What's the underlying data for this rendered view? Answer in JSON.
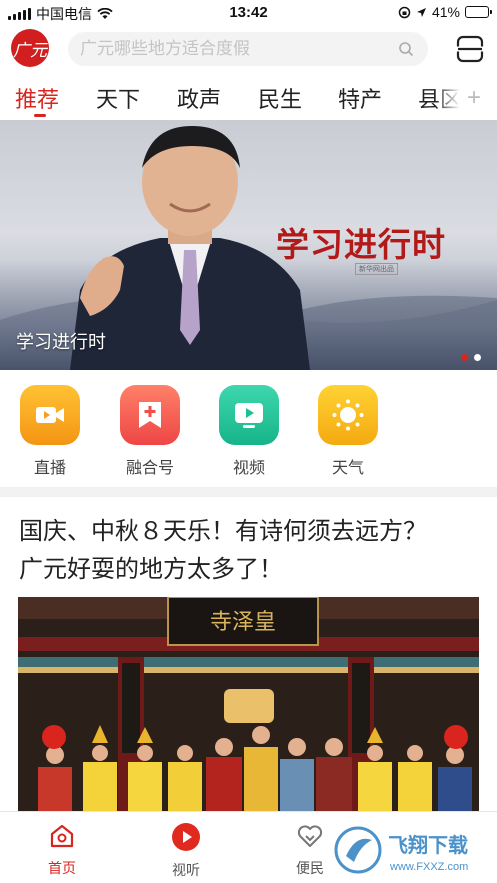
{
  "status_bar": {
    "carrier": "中国电信",
    "time": "13:42",
    "battery_percent_text": "41%",
    "battery_level": 0.41
  },
  "header": {
    "logo_text": "广元",
    "search_placeholder": "广元哪些地方适合度假",
    "icons": {
      "search": "search-icon",
      "scan": "scan-icon"
    }
  },
  "tabs": [
    {
      "label": "推荐",
      "active": true
    },
    {
      "label": "天下",
      "active": false
    },
    {
      "label": "政声",
      "active": false
    },
    {
      "label": "民生",
      "active": false
    },
    {
      "label": "特产",
      "active": false
    },
    {
      "label": "县区",
      "active": false
    }
  ],
  "tab_add_label": "+",
  "banner": {
    "slogan": "学习进行时",
    "sub_tag": "新华网出品",
    "caption": "学习进行时",
    "slide_count": 2,
    "active_slide": 1
  },
  "quick_actions": [
    {
      "label": "直播",
      "icon": "video-camera-icon",
      "color": "#f7a21b"
    },
    {
      "label": "融合号",
      "icon": "add-bookmark-icon",
      "color": "#f25a4b"
    },
    {
      "label": "视频",
      "icon": "play-screen-icon",
      "color": "#20c29a"
    },
    {
      "label": "天气",
      "icon": "sun-icon",
      "color": "#f5be1a"
    }
  ],
  "article": {
    "title_line1": "国庆、中秋８天乐！有诗何须去远方？",
    "title_line2": "广元好耍的地方太多了！",
    "image_sign_text": "寺泽皇"
  },
  "bottom_nav": [
    {
      "label": "首页",
      "icon": "home-icon",
      "active": true
    },
    {
      "label": "视听",
      "icon": "play-circle-icon",
      "active": false
    },
    {
      "label": "便民",
      "icon": "heart-icon",
      "active": false
    }
  ],
  "watermark": {
    "text_cn": "飞翔下载",
    "text_en": "www.FXXZ.com"
  },
  "colors": {
    "accent": "#d8261f",
    "divider": "#f2f2f2"
  }
}
